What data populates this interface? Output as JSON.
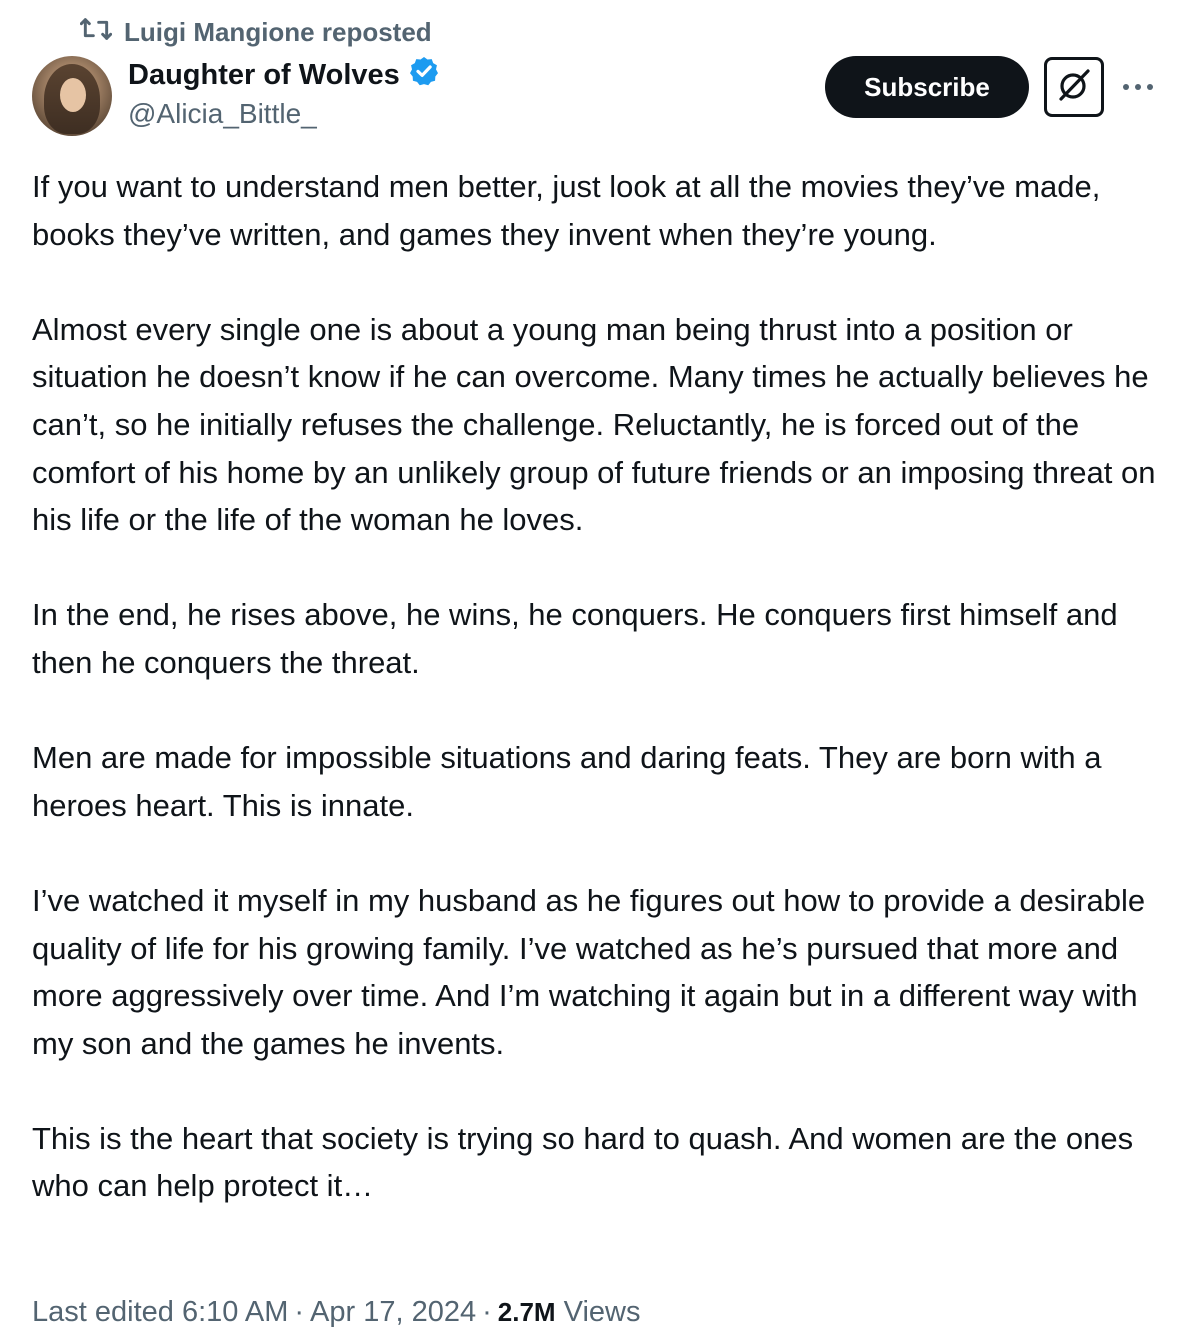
{
  "repost": {
    "text": "Luigi Mangione reposted",
    "icon": "repost-icon"
  },
  "author": {
    "display_name": "Daughter of Wolves",
    "handle": "@Alicia_Bittle_",
    "verified_icon": "verified-badge-icon",
    "avatar": "avatar"
  },
  "actions": {
    "subscribe_label": "Subscribe",
    "grok_icon": "grok-icon",
    "more_icon": "more-icon"
  },
  "post": {
    "paragraphs": [
      "If you want to understand men better, just look at all the movies they’ve made, books they’ve written, and games they invent when they’re young.",
      "Almost every single one is about a young man being thrust into a position or situation he doesn’t know if he can overcome. Many times he actually believes he can’t, so he initially refuses the challenge. Reluctantly, he is forced out of the comfort of his home by an unlikely group of future friends or an imposing threat on his life or the life of the woman he loves.",
      "In the end, he rises above, he wins, he conquers. He conquers first himself and then he conquers the threat.",
      "Men are made for impossible situations and daring feats. They are born with a heroes heart. This is innate.",
      "I’ve watched it myself in my husband as he figures out how to provide a desirable quality of life for his growing family. I’ve watched as he’s pursued that more and more aggressively over time. And I’m watching it again but in a different way with my son and the games he invents.",
      "This is the heart that society is trying so hard to quash. And women are the ones who can help protect it…"
    ]
  },
  "meta": {
    "edited_label": "Last edited",
    "time": "6:10 AM",
    "separator": "·",
    "date": "Apr 17, 2024",
    "views_count": "2.7M",
    "views_label": "Views"
  },
  "colors": {
    "primary_text": "#0f1419",
    "secondary_text": "#536471",
    "verified_blue": "#1d9bf0",
    "button_bg": "#0f1419"
  }
}
